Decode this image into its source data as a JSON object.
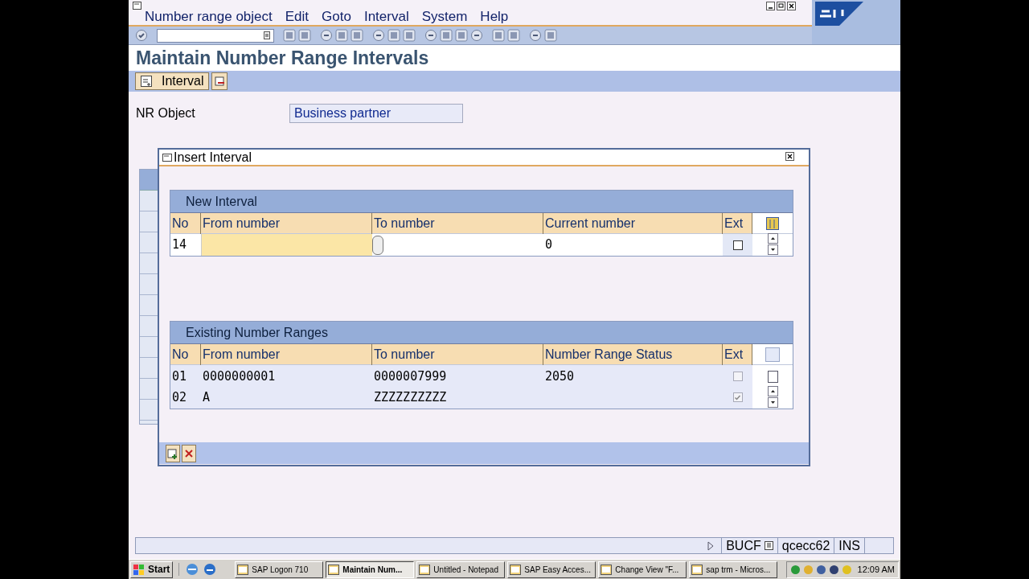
{
  "menu": [
    {
      "label": "Number range object"
    },
    {
      "label": "Edit"
    },
    {
      "label": "Goto"
    },
    {
      "label": "Interval"
    },
    {
      "label": "System"
    },
    {
      "label": "Help"
    }
  ],
  "title": "Maintain Number Range Intervals",
  "app_toolbar": {
    "button": "Interval"
  },
  "nr_object": {
    "label": "NR Object",
    "value": "Business partner"
  },
  "dialog": {
    "title": "Insert Interval",
    "new_interval": {
      "title": "New Interval",
      "columns": [
        "No",
        "From number",
        "To number",
        "Current number",
        "Ext"
      ],
      "row": {
        "no": "14",
        "current": "0",
        "ext": false
      }
    },
    "existing": {
      "title": "Existing Number Ranges",
      "columns": [
        "No",
        "From number",
        "To number",
        "Number Range Status",
        "Ext"
      ],
      "rows": [
        {
          "cells": [
            "01",
            "0000000001",
            "0000007999",
            "2050"
          ],
          "ext": false
        },
        {
          "cells": [
            "02",
            "A",
            "ZZZZZZZZZZ"
          ],
          "ext": true
        }
      ]
    }
  },
  "status_bar": {
    "fields": [
      "BUCF",
      "qcecc62",
      "INS"
    ]
  },
  "taskbar": {
    "start": "Start",
    "tasks": [
      {
        "label": "SAP Logon 710",
        "selected": false
      },
      {
        "label": "Maintain Num...",
        "selected": true
      },
      {
        "label": "Untitled - Notepad",
        "selected": false
      },
      {
        "label": "SAP Easy Acces...",
        "selected": false
      },
      {
        "label": "Change View \"F...",
        "selected": false
      },
      {
        "label": "sap trm - Micros...",
        "selected": false
      }
    ],
    "clock": "12:09 AM"
  }
}
